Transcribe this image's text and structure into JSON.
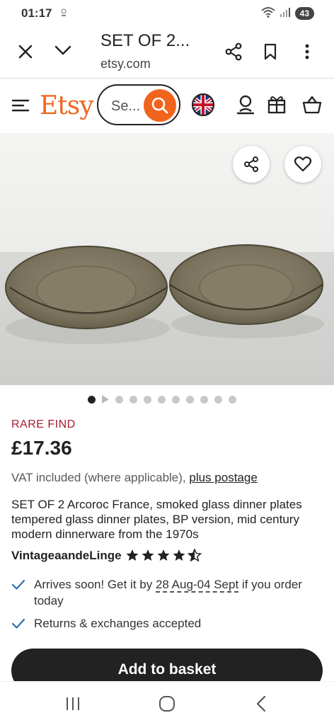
{
  "status_bar": {
    "time": "01:17",
    "battery": "43"
  },
  "browser": {
    "title": "SET OF 2...",
    "url": "etsy.com"
  },
  "header": {
    "logo": "Etsy",
    "search_placeholder": "Se..."
  },
  "gallery": {
    "image_count": 10,
    "active_index": 0
  },
  "product": {
    "badge": "RARE FIND",
    "price": "£17.36",
    "vat_text": "VAT included (where applicable),",
    "postage_link": "plus postage",
    "title": "SET OF 2 Arcoroc France, smoked glass dinner plates tempered glass dinner plates, BP version, mid century modern dinnerware from the 1970s",
    "shop_name": "VintageaandeLinge",
    "rating": 4.5,
    "delivery_prefix": "Arrives soon! Get it by",
    "delivery_dates": "28 Aug-04 Sept",
    "delivery_suffix": "if you order today",
    "returns": "Returns & exchanges accepted",
    "add_to_basket": "Add to basket"
  },
  "colors": {
    "brand": "#F1641E",
    "rare": "#A61A2E",
    "check": "#2A6FB5"
  }
}
